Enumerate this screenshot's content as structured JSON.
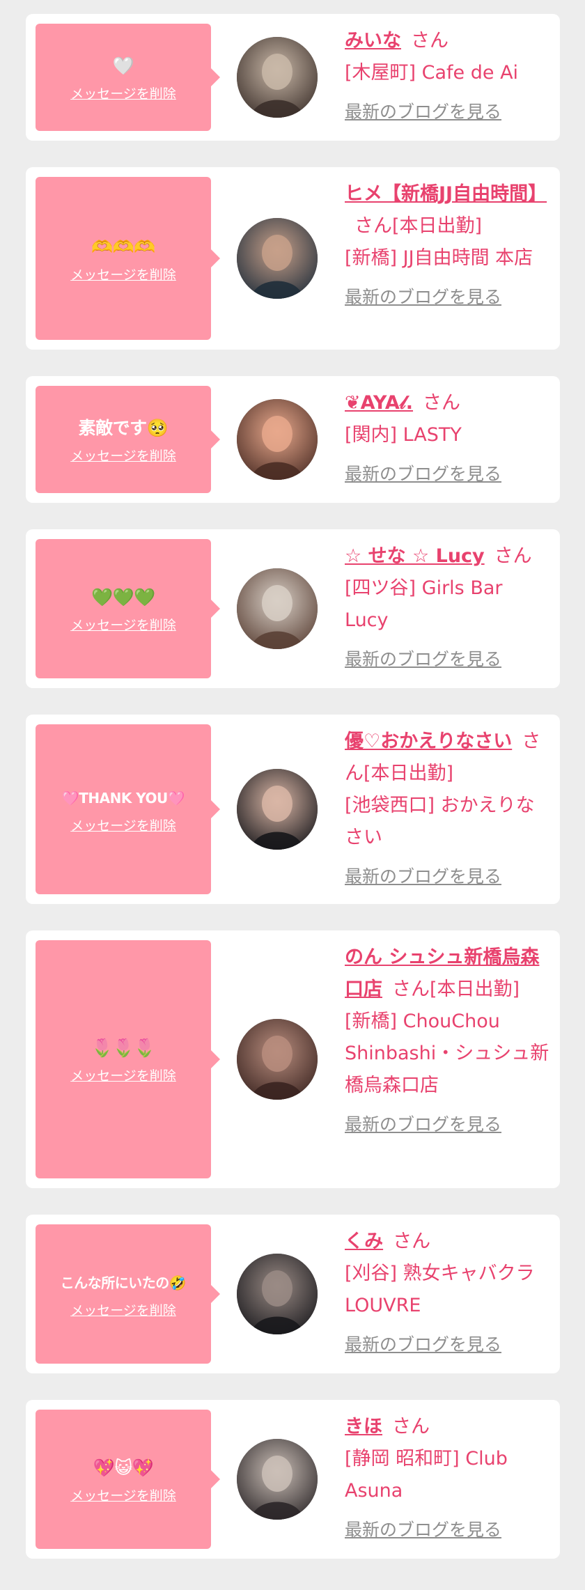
{
  "delete_label": "メッセージを削除",
  "blog_label": "最新のブログを見る",
  "san_label": "さん",
  "colors": {
    "accent": "#e8426e",
    "bubble": "#ff97a8",
    "link_gray": "#8e8e8e",
    "background": "#ededed"
  },
  "items": [
    {
      "message": "🤍",
      "name": "みいな",
      "suffix": "さん",
      "shop": "[木屋町] Cafe de Ai",
      "avatar_colors": [
        "#c9b8a8",
        "#3b2f2a"
      ],
      "height": 182
    },
    {
      "message": "🫶🫶🫶",
      "name": "ヒメ【新橋JJ自由時間】",
      "suffix": "さん[本日出勤]",
      "shop": "[新橋] JJ自由時間 本店",
      "avatar_colors": [
        "#c7a08a",
        "#1f2d3a"
      ],
      "height": 262
    },
    {
      "message": "素敵です🥺",
      "name": "❦AYA𝓁.",
      "suffix": "さん",
      "shop": "[関内] LASTY",
      "avatar_colors": [
        "#e7a88c",
        "#4a2c24"
      ],
      "height": 182
    },
    {
      "message": "💚💚💚",
      "name": "☆ せな ☆ Lucy",
      "suffix": "さん",
      "shop": "[四ツ谷] Girls Bar Lucy",
      "avatar_colors": [
        "#d8cfc6",
        "#5a4035"
      ],
      "height": 228
    },
    {
      "message": "🩷THANK YOU🩷",
      "name": "優♡おかえりなさい",
      "suffix": "さん[本日出勤]",
      "shop": "[池袋西口] おかえりなさい",
      "avatar_colors": [
        "#d9b6a6",
        "#16161a"
      ],
      "height": 262
    },
    {
      "message": "🌷🌷🌷",
      "name": "のん シュシュ新橋烏森口店",
      "suffix": "さん[本日出勤]",
      "shop": "[新橋] ChouChou Shinbashi・シュシュ新橋烏森口店",
      "avatar_colors": [
        "#b88d7e",
        "#3a2420"
      ],
      "height": 370
    },
    {
      "message": "こんな所にいたの🤣",
      "name": "くみ",
      "suffix": "さん",
      "shop": "[刈谷] 熟女キャバクラ LOUVRE",
      "avatar_colors": [
        "#9a8b85",
        "#18181c"
      ],
      "height": 228
    },
    {
      "message": "💖😺💖",
      "name": "きほ",
      "suffix": "さん",
      "shop": "[静岡 昭和町] Club Asuna",
      "avatar_colors": [
        "#cbbfb7",
        "#2b2628"
      ],
      "height": 228
    }
  ]
}
